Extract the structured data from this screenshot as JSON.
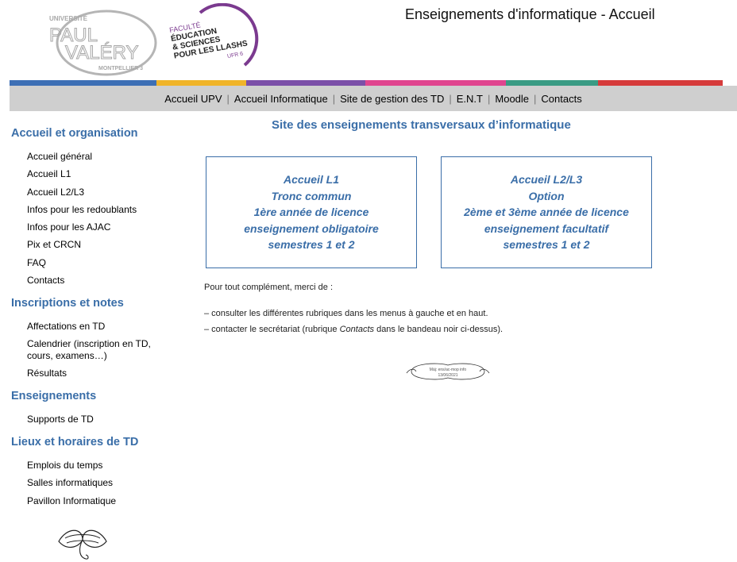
{
  "header": {
    "title": "Enseignements d'informatique - Accueil",
    "logo_upv": {
      "line1": "UNIVERSITÉ",
      "line2": "PAUL",
      "line3": "VALÉRY",
      "line4": "MONTPELLIER 3"
    },
    "logo_faculty": {
      "line1": "FACULTÉ",
      "line2": "ÉDUCATION",
      "line3": "& SCIENCES",
      "line4": "POUR LES LLASHS",
      "line5": "UFR 6"
    }
  },
  "colors": {
    "accent": "#3a6ea8",
    "band": [
      "#3d6fb5",
      "#f0b429",
      "#7b4fa8",
      "#e0458f",
      "#3a9b84",
      "#d63b3b"
    ]
  },
  "topnav": {
    "items": [
      {
        "label": "Accueil UPV"
      },
      {
        "label": "Accueil Informatique"
      },
      {
        "label": "Site de gestion des TD"
      },
      {
        "label": "E.N.T"
      },
      {
        "label": "Moodle"
      },
      {
        "label": "Contacts"
      }
    ]
  },
  "sidebar": {
    "sections": [
      {
        "title": "Accueil et organisation",
        "items": [
          "Accueil général",
          "Accueil L1",
          "Accueil L2/L3",
          "Infos pour les redoublants",
          "Infos pour les AJAC",
          "Pix et CRCN",
          "FAQ",
          "Contacts"
        ]
      },
      {
        "title": "Inscriptions et notes",
        "items": [
          "Affectations en TD",
          "Calendrier (inscription en TD, cours, examens…)",
          "Résultats"
        ]
      },
      {
        "title": "Enseignements",
        "items": [
          "Supports de TD"
        ]
      },
      {
        "title": "Lieux et horaires de TD",
        "items": [
          "Emplois du temps",
          "Salles informatiques",
          "Pavillon Informatique"
        ]
      }
    ]
  },
  "main": {
    "title": "Site des enseignements transversaux d’informatique",
    "cards": [
      {
        "lines": [
          "Accueil L1",
          "Tronc commun",
          "1ère année de licence",
          "enseignement obligatoire",
          "semestres 1 et 2"
        ]
      },
      {
        "lines": [
          "Accueil L2/L3",
          "Option",
          "2ème et 3ème année de licence",
          "enseignement facultatif",
          "semestres 1 et 2"
        ]
      }
    ],
    "intro": "Pour tout complément, merci de :",
    "bullet1": "– consulter les différentes rubriques dans les menus à gauche et en haut.",
    "bullet2_before": "– contacter le secrétariat (rubrique ",
    "bullet2_em": "Contacts",
    "bullet2_after": " dans le bandeau noir ci-dessus).",
    "signature": {
      "line1": "Màj: ens/ac-mop info",
      "line2": "13/06/2021"
    }
  }
}
